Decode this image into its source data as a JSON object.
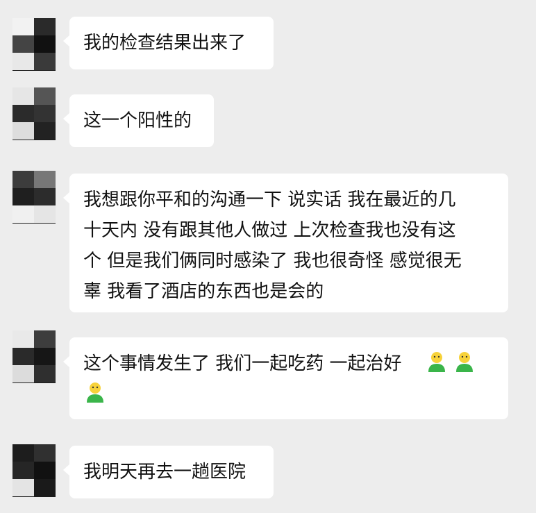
{
  "messages": [
    {
      "text": "我的检查结果出来了"
    },
    {
      "text": "这一个阳性的"
    },
    {
      "lines": [
        "我想跟你平和的沟通一下 说实话 我在最近的几",
        "十天内 没有跟其他人做过 上次检查我也没有这",
        "个 但是我们俩同时感染了 我也很奇怪 感觉很无",
        "辜 我看了酒店的东西也是会的"
      ]
    },
    {
      "text": "这个事情发生了 我们一起吃药 一起治好",
      "emoji_count": 3,
      "emoji_name": "person-emoji"
    },
    {
      "text": "我明天再去一趟医院"
    }
  ],
  "colors": {
    "background": "#ededed",
    "bubble": "#ffffff",
    "text": "#111111",
    "emoji_skin": "#f7d23a",
    "emoji_body": "#3ab54a"
  }
}
